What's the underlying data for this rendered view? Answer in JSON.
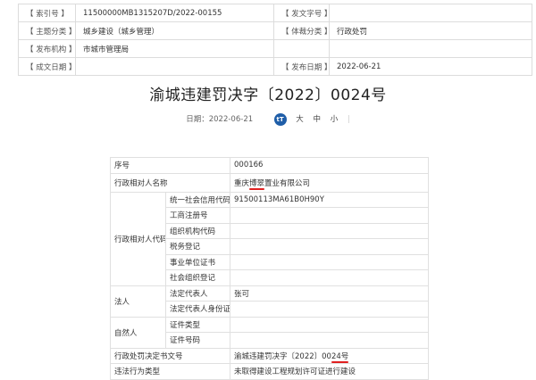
{
  "meta": {
    "index_label": "【 索引号 】",
    "index_value": "11500000MB1315207D/2022-00155",
    "doc_no_label": "【 发文字号 】",
    "doc_no_value": "",
    "subject_label": "【 主题分类 】",
    "subject_value": "城乡建设（城乡管理）",
    "genre_label": "【 体裁分类 】",
    "genre_value": "行政处罚",
    "publisher_label": "【 发布机构 】",
    "publisher_value": "市城市管理局",
    "effective_label": "【 成文日期 】",
    "effective_value": "",
    "publish_label": "【 发布日期 】",
    "publish_value": "2022-06-21"
  },
  "title": "渝城违建罚决字〔2022〕0024号",
  "dateline": {
    "date_label": "日期：",
    "date_value": "2022-06-21",
    "font_icon": "tT",
    "size_large": "大",
    "size_medium": "中",
    "size_small": "小"
  },
  "table": {
    "serial_label": "序号",
    "serial_value": "000166",
    "party_name_label": "行政相对人名称",
    "party_name_prefix": "重庆",
    "party_name_underlined": "博翠",
    "party_name_suffix": "置业有限公司",
    "party_code_label": "行政相对人代码",
    "credit_code_label": "统一社会信用代码",
    "credit_code_value": "91500113MA61B0H90Y",
    "business_reg_label": "工商注册号",
    "org_code_label": "组织机构代码",
    "tax_reg_label": "税务登记",
    "institution_label": "事业单位证书",
    "social_org_label": "社会组织登记",
    "legal_person_label": "法人",
    "legal_rep_label": "法定代表人",
    "legal_rep_value": "张可",
    "legal_rep_id_label": "法定代表人身份证",
    "natural_person_label": "自然人",
    "id_type_label": "证件类型",
    "id_number_label": "证件号码",
    "decision_no_label": "行政处罚决定书文号",
    "decision_no_prefix": "渝城违建罚决字〔2022〕00",
    "decision_no_underlined": "24号",
    "violation_type_label": "违法行为类型",
    "violation_type_value": "未取得建设工程规划许可证进行建设"
  }
}
